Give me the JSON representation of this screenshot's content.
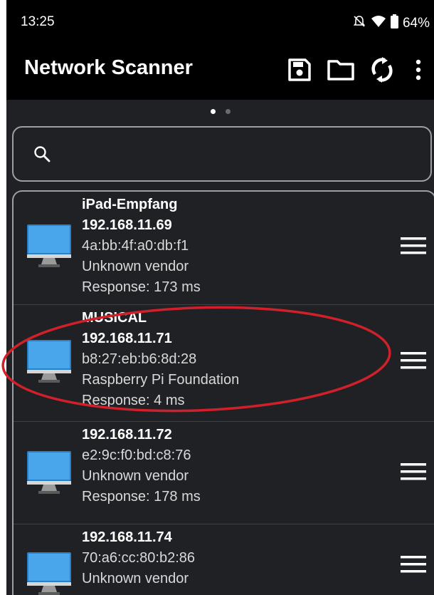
{
  "status_bar": {
    "time": "13:25",
    "battery": "64%",
    "icons": [
      "alarm-off-icon",
      "wifi-icon",
      "battery-icon"
    ]
  },
  "app_bar": {
    "title": "Network Scanner",
    "actions": [
      "save-icon",
      "folder-icon",
      "refresh-icon",
      "more-vert-icon"
    ]
  },
  "pager": {
    "pages": 2,
    "active": 0
  },
  "search": {
    "value": "",
    "placeholder": ""
  },
  "devices": [
    {
      "name": "iPad-Empfang",
      "ip": "192.168.11.69",
      "mac": "4a:bb:4f:a0:db:f1",
      "vendor": "Unknown vendor",
      "response": "Response: 173 ms"
    },
    {
      "name": "MUSICAL",
      "ip": "192.168.11.71",
      "mac": "b8:27:eb:b6:8d:28",
      "vendor": "Raspberry Pi Foundation",
      "response": "Response: 4 ms",
      "highlighted": true
    },
    {
      "ip": "192.168.11.72",
      "mac": "e2:9c:f0:bd:c8:76",
      "vendor": "Unknown vendor",
      "response": "Response: 178 ms"
    },
    {
      "ip": "192.168.11.74",
      "mac": "70:a6:cc:80:b2:86",
      "vendor": "Unknown vendor"
    }
  ],
  "colors": {
    "background": "#202124",
    "bar": "#000000",
    "outline": "#9aa0a6",
    "annotation": "#d0202a",
    "monitor": "#3c9be0"
  }
}
